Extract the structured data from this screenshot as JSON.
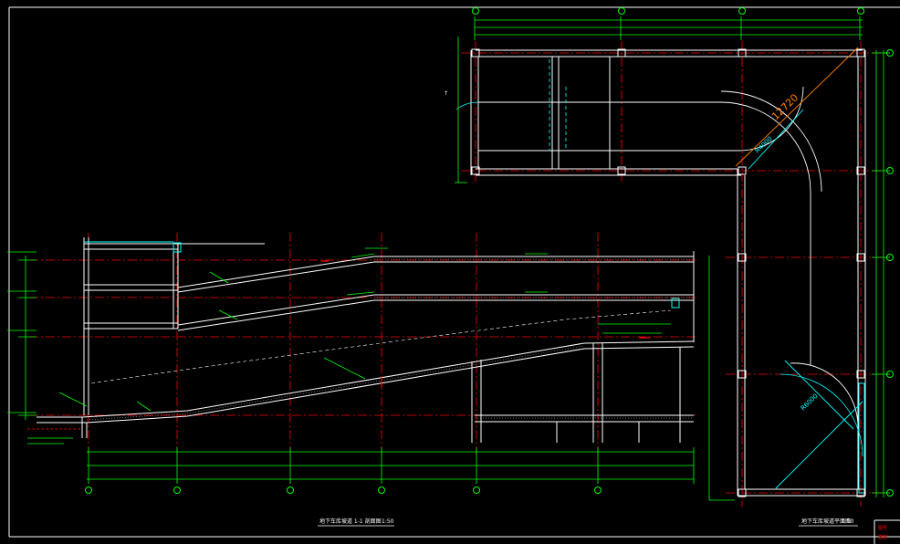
{
  "colors": {
    "background": "#000000",
    "structure": "#ffffff",
    "axis": "#ff0000",
    "dimension": "#00ff00",
    "annotation": "#00ffff",
    "accent": "#ff8000"
  },
  "plan_view": {
    "dimension_large": "12720",
    "radius_1": "R4000",
    "radius_2": "R6000",
    "title": "地下车库坡道平面图",
    "scale": "1:50"
  },
  "section_view": {
    "title": "地下车库坡道 1-1 剖面图",
    "scale": "1:50"
  },
  "title_block": {
    "line_1": "图号",
    "line_2": "建施"
  },
  "icons": [
    "axis-bubble-icon",
    "north-tick-icon"
  ]
}
